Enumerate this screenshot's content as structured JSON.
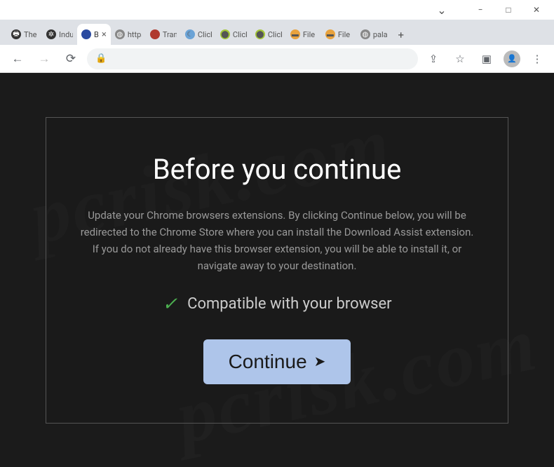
{
  "window": {
    "minimize": "−",
    "maximize": "□",
    "close": "✕",
    "chevron": "⌄"
  },
  "tabs": [
    {
      "title": "The I",
      "favClass": "fav-printer",
      "favGlyph": "🖶",
      "active": false
    },
    {
      "title": "Indu",
      "favClass": "fav-film",
      "favGlyph": "✲",
      "active": false
    },
    {
      "title": "B",
      "favClass": "fav-blue",
      "favGlyph": "",
      "active": true
    },
    {
      "title": "https",
      "favClass": "fav-globe",
      "favGlyph": "◍",
      "active": false
    },
    {
      "title": "Trans",
      "favClass": "fav-red",
      "favGlyph": "",
      "active": false
    },
    {
      "title": "Click",
      "favClass": "fav-cresc",
      "favGlyph": "☾",
      "active": false
    },
    {
      "title": "Click",
      "favClass": "fav-android",
      "favGlyph": "⬤",
      "active": false
    },
    {
      "title": "Click",
      "favClass": "fav-android",
      "favGlyph": "⬤",
      "active": false
    },
    {
      "title": "File D",
      "favClass": "fav-folder",
      "favGlyph": "▬",
      "active": false
    },
    {
      "title": "File D",
      "favClass": "fav-folder",
      "favGlyph": "▬",
      "active": false
    },
    {
      "title": "palac",
      "favClass": "fav-globe",
      "favGlyph": "◍",
      "active": false
    }
  ],
  "tabClose": "×",
  "newTab": "+",
  "nav": {
    "back": "←",
    "forward": "→",
    "reload": "⟳",
    "lock": "🔒",
    "share": "⇪",
    "star": "☆",
    "panel": "▣",
    "menu": "⋮"
  },
  "page": {
    "title": "Before you continue",
    "body": "Update your Chrome browsers extensions. By clicking Continue below, you will be redirected to the Chrome Store where you can install the Download Assist extension. If you do not already have this browser extension, you will be able to install it, or navigate away to your destination.",
    "compat": "Compatible with your browser",
    "checkmark": "✓",
    "button": "Continue",
    "arrow": "➤"
  },
  "watermark": "pcrisk.com"
}
